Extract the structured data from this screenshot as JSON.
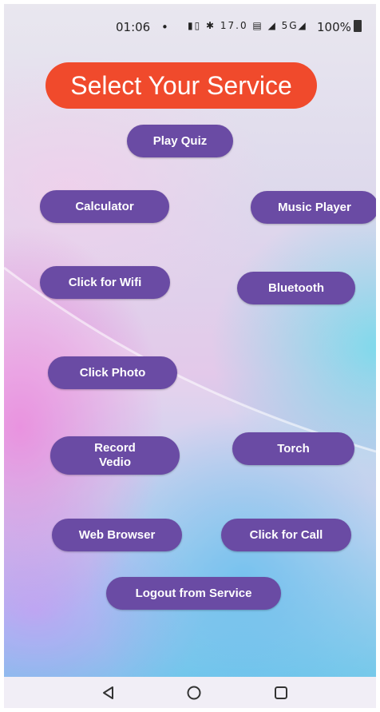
{
  "status_bar": {
    "time": "01:06",
    "dot": "•",
    "icons": "▮▯ ✱ 17.0 ▤ ◢ 5G◢",
    "battery": "100%"
  },
  "title": "Select Your Service",
  "buttons": {
    "play_quiz": "Play Quiz",
    "calculator": "Calculator",
    "music_player": "Music Player",
    "wifi": "Click for Wifi",
    "bluetooth": "Bluetooth",
    "photo": "Click Photo",
    "record_video": "Record\nVedio",
    "torch": "Torch",
    "web_browser": "Web Browser",
    "call": "Click for Call",
    "logout": "Logout from Service"
  },
  "nav_bar": {
    "back_icon": "back-triangle",
    "home_icon": "home-circle",
    "recents_icon": "recents-square"
  },
  "colors": {
    "title_bg": "#f04a2c",
    "button_bg": "#6a4ba4",
    "button_text": "#ffffff"
  }
}
